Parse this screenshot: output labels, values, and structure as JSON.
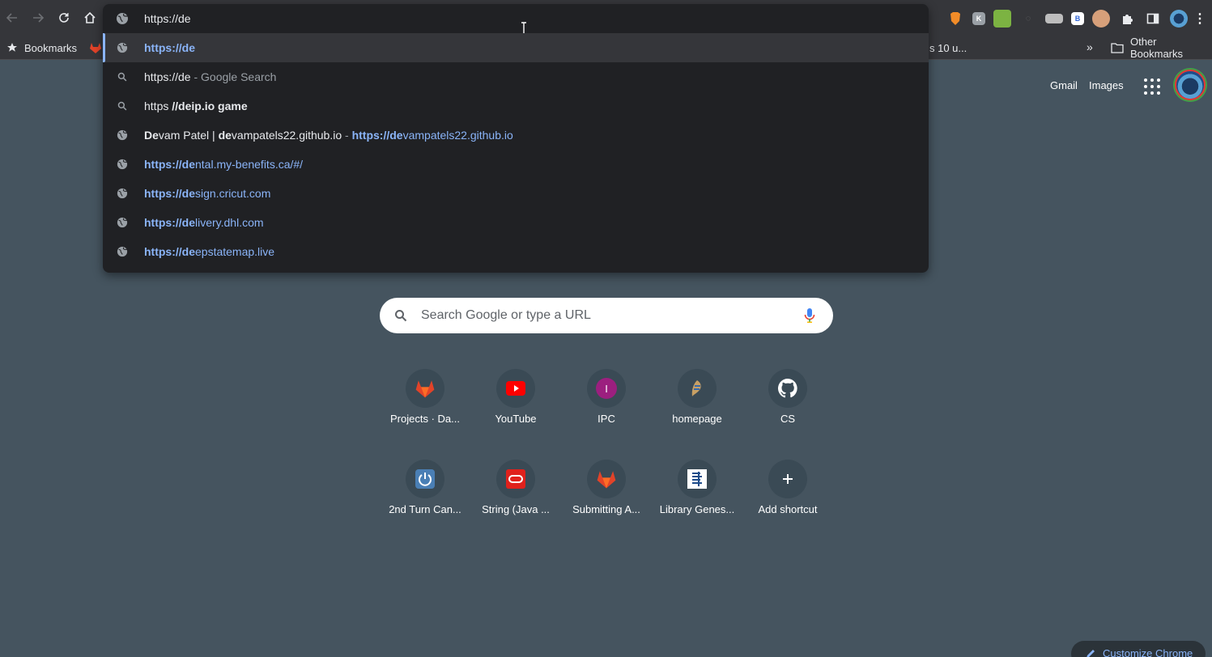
{
  "toolbar": {
    "back_icon": "arrow-left-icon",
    "forward_icon": "arrow-right-icon",
    "reload_icon": "reload-icon",
    "home_icon": "home-icon"
  },
  "bookmarks_bar": {
    "bookmarks_label": "Bookmarks",
    "partial_item": "s 10 u...",
    "overflow_label": "»",
    "other_bookmarks": "Other Bookmarks"
  },
  "omnibox": {
    "value": "https://de",
    "suggestions": [
      {
        "type": "url",
        "selected": true,
        "parts": [
          {
            "t": "https://de",
            "cls": "blue b"
          }
        ]
      },
      {
        "type": "search",
        "parts": [
          {
            "t": "https://de",
            "cls": ""
          },
          {
            "t": " - Google Search",
            "cls": "dim"
          }
        ]
      },
      {
        "type": "search",
        "parts": [
          {
            "t": "https ",
            "cls": ""
          },
          {
            "t": "//de",
            "cls": "b"
          },
          {
            "t": "ip.io game",
            "cls": "b"
          }
        ]
      },
      {
        "type": "url",
        "parts": [
          {
            "t": "De",
            "cls": "b"
          },
          {
            "t": "vam Patel | ",
            "cls": ""
          },
          {
            "t": "de",
            "cls": "b"
          },
          {
            "t": "vampatels22.github.io",
            "cls": ""
          },
          {
            "t": " - ",
            "cls": "dim"
          },
          {
            "t": "https://de",
            "cls": "blue b"
          },
          {
            "t": "vampatels22.github.io",
            "cls": "blue"
          }
        ]
      },
      {
        "type": "url",
        "parts": [
          {
            "t": "https://de",
            "cls": "blue b"
          },
          {
            "t": "ntal.my-benefits.ca/#/",
            "cls": "blue"
          }
        ]
      },
      {
        "type": "url",
        "parts": [
          {
            "t": "https://de",
            "cls": "blue b"
          },
          {
            "t": "sign.cricut.com",
            "cls": "blue"
          }
        ]
      },
      {
        "type": "url",
        "parts": [
          {
            "t": "https://de",
            "cls": "blue b"
          },
          {
            "t": "livery.dhl.com",
            "cls": "blue"
          }
        ]
      },
      {
        "type": "url",
        "parts": [
          {
            "t": "https://de",
            "cls": "blue b"
          },
          {
            "t": "epstatemap.live",
            "cls": "blue"
          }
        ]
      }
    ]
  },
  "topright": {
    "gmail": "Gmail",
    "images": "Images"
  },
  "search": {
    "placeholder": "Search Google or type a URL"
  },
  "shortcuts": [
    {
      "label": "Projects · Da...",
      "icon": "gitlab-icon"
    },
    {
      "label": "YouTube",
      "icon": "youtube-icon"
    },
    {
      "label": "IPC",
      "icon": "letter-i-icon",
      "letter": "I"
    },
    {
      "label": "homepage",
      "icon": "homepage-icon"
    },
    {
      "label": "CS",
      "icon": "github-icon"
    },
    {
      "label": "2nd Turn Can...",
      "icon": "power-icon"
    },
    {
      "label": "String (Java ...",
      "icon": "oracle-icon"
    },
    {
      "label": "Submitting A...",
      "icon": "gitlab-icon"
    },
    {
      "label": "Library Genes...",
      "icon": "library-icon"
    },
    {
      "label": "Add shortcut",
      "icon": "plus-icon"
    }
  ],
  "customize": {
    "label": "Customize Chrome"
  }
}
